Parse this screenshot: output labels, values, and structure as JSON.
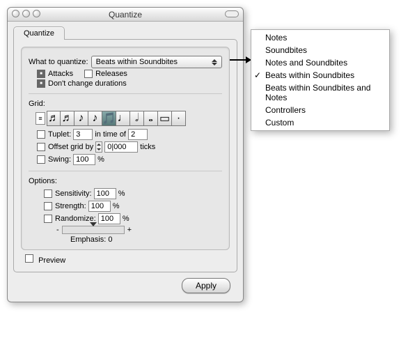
{
  "window": {
    "title": "Quantize"
  },
  "tab": {
    "label": "Quantize"
  },
  "quantize": {
    "what_label": "What to quantize:",
    "select_value": "Beats within Soundbites",
    "attacks_label": "Attacks",
    "releases_label": "Releases",
    "dont_change_label": "Don't change durations"
  },
  "grid": {
    "label": "Grid:",
    "notes": [
      "♬",
      "♬",
      "♪",
      "♪",
      "🎵",
      "♩",
      "𝅗𝅥",
      "𝅝",
      "▭",
      "·"
    ],
    "tuplet_label": "Tuplet:",
    "tuplet_a": "3",
    "tuplet_mid": "in time of",
    "tuplet_b": "2",
    "offset_label": "Offset grid by",
    "offset_value": "0|000",
    "offset_unit": "ticks",
    "swing_label": "Swing:",
    "swing_value": "100",
    "swing_unit": "%"
  },
  "options": {
    "label": "Options:",
    "sensitivity_label": "Sensitivity:",
    "sensitivity_value": "100",
    "strength_label": "Strength:",
    "strength_value": "100",
    "randomize_label": "Randomize:",
    "randomize_value": "100",
    "pct": "%",
    "minus": "-",
    "plus": "+",
    "emphasis_label": "Emphasis: 0"
  },
  "footer": {
    "preview_label": "Preview",
    "apply_label": "Apply"
  },
  "menu": {
    "items": [
      "Notes",
      "Soundbites",
      "Notes and Soundbites",
      "Beats within Soundbites",
      "Beats within Soundbites and Notes",
      "Controllers",
      "Custom"
    ],
    "checkedIndex": 3
  }
}
